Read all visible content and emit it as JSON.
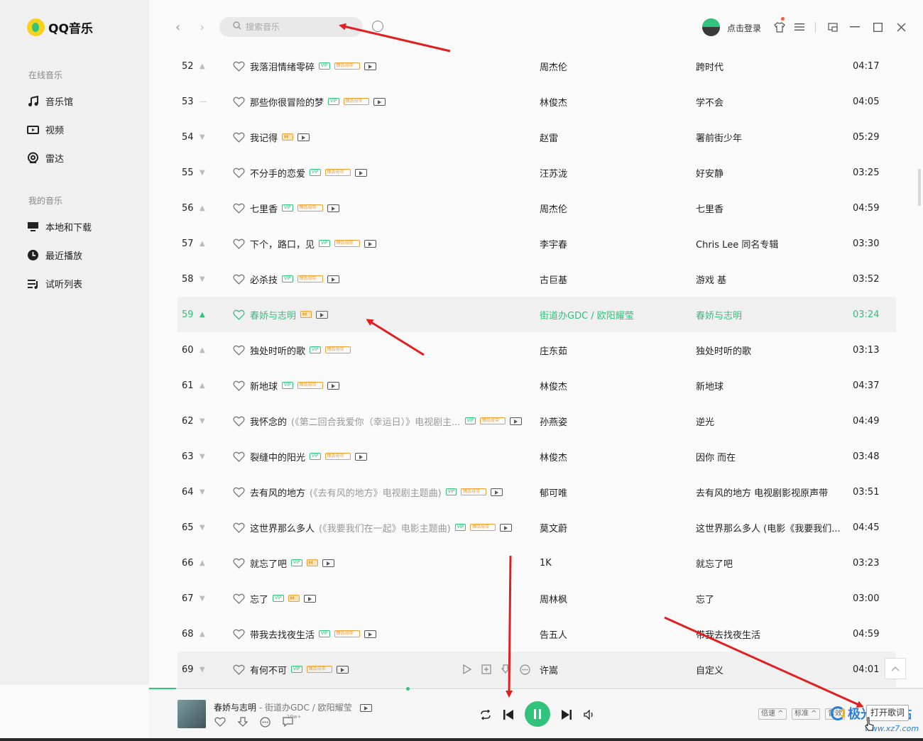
{
  "app": {
    "logo_text": "QQ音乐",
    "brand_color": "#31c27c",
    "arrow_color": "#e02020"
  },
  "sidebar": {
    "online_title": "在线音乐",
    "online_items": [
      {
        "label": "音乐馆",
        "icon": "music-note-icon"
      },
      {
        "label": "视频",
        "icon": "video-icon"
      },
      {
        "label": "雷达",
        "icon": "radar-icon"
      }
    ],
    "mine_title": "我的音乐",
    "mine_items": [
      {
        "label": "本地和下载",
        "icon": "computer-icon"
      },
      {
        "label": "最近播放",
        "icon": "clock-icon"
      },
      {
        "label": "试听列表",
        "icon": "playlist-icon"
      }
    ]
  },
  "topbar": {
    "search_placeholder": "搜索音乐",
    "login_text": "点击登录"
  },
  "songs": [
    {
      "num": "52",
      "trend": "up",
      "title": "我落泪情绪零碎",
      "sub": "",
      "tags": [
        "vip",
        "sq",
        "mv"
      ],
      "singer": "周杰伦",
      "album": "跨时代",
      "time": "04:17"
    },
    {
      "num": "53",
      "trend": "flat",
      "title": "那些你很冒险的梦",
      "sub": "",
      "tags": [
        "vip",
        "sq",
        "mv"
      ],
      "singer": "林俊杰",
      "album": "学不会",
      "time": "04:05"
    },
    {
      "num": "54",
      "trend": "down",
      "title": "我记得",
      "sub": "",
      "tags": [
        "dolby",
        "mv"
      ],
      "singer": "赵雷",
      "album": "署前街少年",
      "time": "05:29"
    },
    {
      "num": "55",
      "trend": "down",
      "title": "不分手的恋爱",
      "sub": "",
      "tags": [
        "vip",
        "sq",
        "mv"
      ],
      "singer": "汪苏泷",
      "album": "好安静",
      "time": "03:25"
    },
    {
      "num": "56",
      "trend": "up",
      "title": "七里香",
      "sub": "",
      "tags": [
        "vip",
        "sq",
        "mv"
      ],
      "singer": "周杰伦",
      "album": "七里香",
      "time": "04:59"
    },
    {
      "num": "57",
      "trend": "up",
      "title": "下个，路口，见",
      "sub": "",
      "tags": [
        "vip",
        "sq",
        "mv"
      ],
      "singer": "李宇春",
      "album": "Chris Lee 同名专辑",
      "time": "03:30"
    },
    {
      "num": "58",
      "trend": "down",
      "title": "必杀技",
      "sub": "",
      "tags": [
        "vip",
        "sq",
        "mv"
      ],
      "singer": "古巨基",
      "album": "游戏 基",
      "time": "03:52"
    },
    {
      "num": "59",
      "trend": "up",
      "title": "春娇与志明",
      "sub": "",
      "tags": [
        "dolby",
        "mv"
      ],
      "singer": "街道办GDC / 欧阳耀莹",
      "album": "春娇与志明",
      "time": "03:24",
      "active": true
    },
    {
      "num": "60",
      "trend": "up",
      "title": "独处时听的歌",
      "sub": "",
      "tags": [
        "vip",
        "sq"
      ],
      "singer": "庄东茹",
      "album": "独处时听的歌",
      "time": "03:13"
    },
    {
      "num": "61",
      "trend": "up",
      "title": "新地球",
      "sub": "",
      "tags": [
        "vip",
        "sq",
        "mv"
      ],
      "singer": "林俊杰",
      "album": "新地球",
      "time": "04:37"
    },
    {
      "num": "62",
      "trend": "down",
      "title": "我怀念的",
      "sub": "(《第二回合我爱你（幸运日）》电视剧主...",
      "tags": [
        "vip",
        "sq",
        "mv"
      ],
      "singer": "孙燕姿",
      "album": "逆光",
      "time": "04:49"
    },
    {
      "num": "63",
      "trend": "down",
      "title": "裂缝中的阳光",
      "sub": "",
      "tags": [
        "vip",
        "sq",
        "mv"
      ],
      "singer": "林俊杰",
      "album": "因你 而在",
      "time": "03:48"
    },
    {
      "num": "64",
      "trend": "down",
      "title": "去有风的地方",
      "sub": "(《去有风的地方》电视剧主题曲)",
      "tags": [
        "vip",
        "sq",
        "mv"
      ],
      "singer": "郁可唯",
      "album": "去有风的地方 电视剧影视原声带",
      "time": "03:51"
    },
    {
      "num": "65",
      "trend": "down",
      "title": "这世界那么多人",
      "sub": "(《我要我们在一起》电影主题曲)",
      "tags": [
        "vip",
        "sq",
        "mv"
      ],
      "singer": "莫文蔚",
      "album": "这世界那么多人 (电影《我要我们...",
      "time": "04:45"
    },
    {
      "num": "66",
      "trend": "up",
      "title": "就忘了吧",
      "sub": "",
      "tags": [
        "vip",
        "dolby",
        "mv"
      ],
      "singer": "1K",
      "album": "就忘了吧",
      "time": "03:23"
    },
    {
      "num": "67",
      "trend": "down",
      "title": "忘了",
      "sub": "",
      "tags": [
        "vip",
        "dolby",
        "mv"
      ],
      "singer": "周林枫",
      "album": "忘了",
      "time": "03:00"
    },
    {
      "num": "68",
      "trend": "up",
      "title": "带我去找夜生活",
      "sub": "",
      "tags": [
        "vip",
        "sq",
        "mv"
      ],
      "singer": "告五人",
      "album": "带我去找夜生活",
      "time": "04:59"
    },
    {
      "num": "69",
      "trend": "down",
      "title": "有何不可",
      "sub": "",
      "tags": [
        "vip",
        "sq",
        "mv"
      ],
      "singer": "许嵩",
      "album": "自定义",
      "time": "04:01",
      "hover": true
    }
  ],
  "tag_labels": {
    "vip": "VIP",
    "sq": "臻品母带",
    "dolby": "◗◖",
    "mv": ""
  },
  "player": {
    "song": "春娇与志明",
    "separator": " - ",
    "artist": "街道办GDC / 欧阳耀莹",
    "comment_count": "10w+",
    "speed_label": "倍速",
    "quality_label": "标准",
    "effect_label": "音效",
    "lyric_button": "打开歌词",
    "progress": 0.035
  },
  "watermark": {
    "text": "极光下载站",
    "url": "www.xz7.com"
  }
}
